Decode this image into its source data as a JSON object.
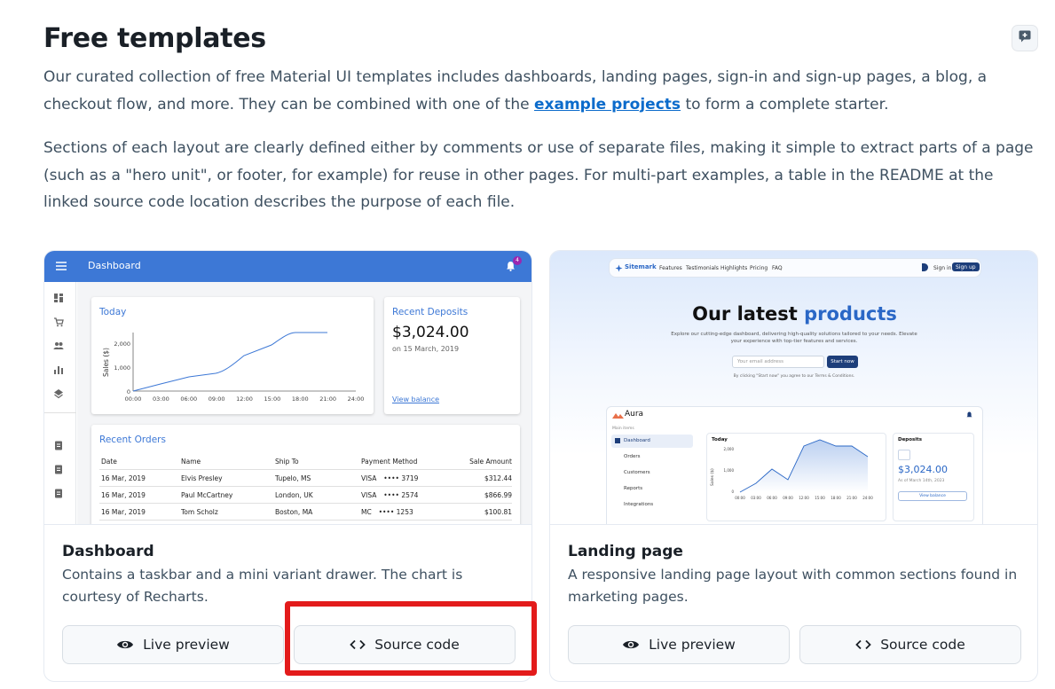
{
  "page": {
    "title": "Free templates",
    "p1_before": "Our curated collection of free Material UI templates includes dashboards, landing pages, sign-in and sign-up pages, a blog, a checkout flow, and more. They can be combined with one of the ",
    "p1_link": "example projects",
    "p1_after": " to form a complete starter.",
    "p2": "Sections of each layout are clearly defined either by comments or use of separate files, making it simple to extract parts of a page (such as a \"hero unit\", or footer, for example) for reuse in other pages. For multi-part examples, a table in the README at the linked source code location describes the purpose of each file."
  },
  "icons": {
    "feedback": "comment-add-icon",
    "live_preview": "eye-icon",
    "source_code": "code-brackets-icon"
  },
  "colors": {
    "accent": "#0b6bcb",
    "dashboard_appbar": "#3d78d6",
    "highlight": "#e31b1b"
  },
  "cards": [
    {
      "title": "Dashboard",
      "description": "Contains a taskbar and a mini variant drawer. The chart is courtesy of Recharts.",
      "live_preview": "Live preview",
      "source_code": "Source code",
      "thumb": {
        "appbar_title": "Dashboard",
        "badge": "4",
        "today": "Today",
        "y_axis": "Sales ($)",
        "y_ticks": [
          "2,000",
          "1,000",
          "0"
        ],
        "x_ticks": [
          "00:00",
          "03:00",
          "06:00",
          "09:00",
          "12:00",
          "15:00",
          "18:00",
          "21:00",
          "24:00"
        ],
        "deposits_title": "Recent Deposits",
        "deposits_amount": "$3,024.00",
        "deposits_date": "on 15 March, 2019",
        "view_balance": "View balance",
        "orders_title": "Recent Orders",
        "orders_headers": [
          "Date",
          "Name",
          "Ship To",
          "Payment Method",
          "Sale Amount"
        ],
        "orders_rows": [
          [
            "16 Mar, 2019",
            "Elvis Presley",
            "Tupelo, MS",
            "VISA ⠀•••• 3719",
            "$312.44"
          ],
          [
            "16 Mar, 2019",
            "Paul McCartney",
            "London, UK",
            "VISA ⠀•••• 2574",
            "$866.99"
          ],
          [
            "16 Mar, 2019",
            "Tom Scholz",
            "Boston, MA",
            "MC ⠀•••• 1253",
            "$100.81"
          ]
        ]
      }
    },
    {
      "title": "Landing page",
      "description": "A responsive landing page layout with common sections found in marketing pages.",
      "live_preview": "Live preview",
      "source_code": "Source code",
      "thumb": {
        "brand": "Sitemark",
        "nav": [
          "Features",
          "Testimonials",
          "Highlights",
          "Pricing",
          "FAQ"
        ],
        "sign_in": "Sign in",
        "sign_up": "Sign up",
        "hero_1": "Our latest ",
        "hero_2": "products",
        "sub": "Explore our cutting-edge dashboard, delivering high-quality solutions tailored to your needs. Elevate your experience with top-tier features and services.",
        "email_placeholder": "Your email address",
        "start_now": "Start now",
        "terms": "By clicking \"Start now\" you agree to our Terms & Conditions.",
        "aura": "Aura",
        "main_items": "Main items",
        "side_items": [
          "Dashboard",
          "Orders",
          "Customers",
          "Reports",
          "Integrations"
        ],
        "today": "Today",
        "y_axis": "Sales ($)",
        "y_ticks": [
          "2,000",
          "1,000",
          "0"
        ],
        "x_ticks": [
          "00:00",
          "03:00",
          "06:00",
          "09:00",
          "12:00",
          "15:00",
          "18:00",
          "21:00",
          "24:00"
        ],
        "deposits_title": "Deposits",
        "deposits_amount": "$3,024.00",
        "deposits_date": "As of March 14th, 2023",
        "view_balance": "View balance"
      }
    }
  ]
}
